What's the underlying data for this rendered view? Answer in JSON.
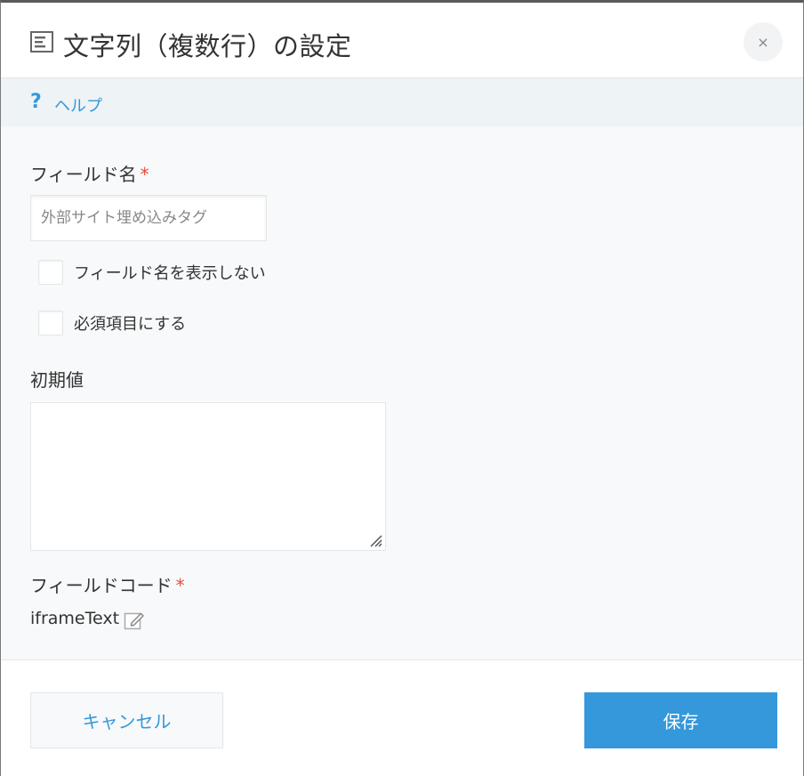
{
  "dialog": {
    "title": "文字列（複数行）の設定",
    "title_icon": "text-area-icon",
    "close_icon": "close-icon",
    "close_label": "×"
  },
  "help": {
    "icon_glyph": "?",
    "label": "ヘルプ"
  },
  "form": {
    "field_name": {
      "label": "フィールド名",
      "required_mark": "*",
      "placeholder": "外部サイト埋め込みタグ",
      "value": ""
    },
    "hide_field_name": {
      "label": "フィールド名を表示しない",
      "checked": false
    },
    "required": {
      "label": "必須項目にする",
      "checked": false
    },
    "default_value": {
      "label": "初期値",
      "value": ""
    },
    "field_code": {
      "label": "フィールドコード",
      "required_mark": "*",
      "value": "iframeText",
      "edit_icon": "edit-icon"
    }
  },
  "footer": {
    "cancel_label": "キャンセル",
    "save_label": "保存"
  },
  "colors": {
    "accent": "#3498db",
    "required": "#e74c3c",
    "body_bg": "#f7f9fa",
    "help_bg": "#eef3f6"
  }
}
